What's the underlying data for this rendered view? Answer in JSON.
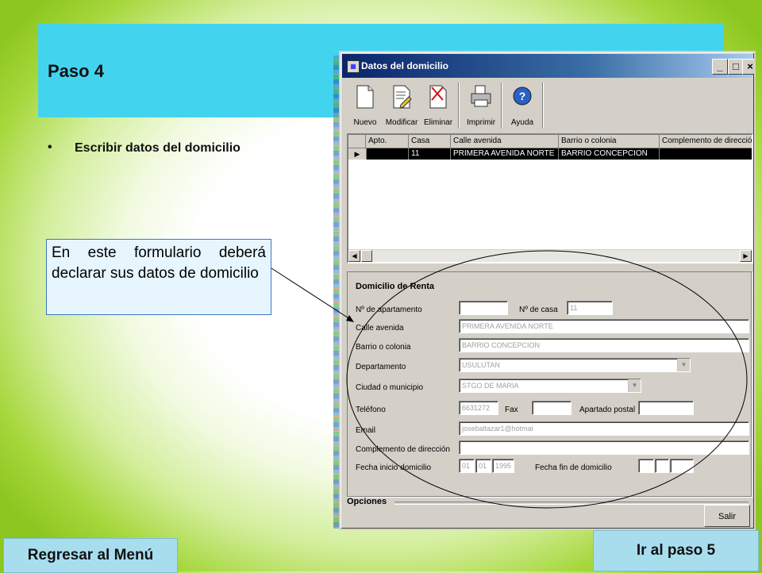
{
  "slide": {
    "title": "Paso 4",
    "bullet": "Escribir datos del domicilio",
    "callout": "En este formulario deberá declarar sus datos de domicilio",
    "nav": {
      "menu": "Regresar al Menú",
      "next": "Ir al paso 5"
    },
    "colors": {
      "header_band": "#42d4ee",
      "nav_button": "#a8ddee",
      "callout_bg": "#e7f5ff",
      "edge_green": "#8cc61f"
    }
  },
  "window": {
    "title": "Datos del domicilio",
    "controls": {
      "minimize": "_",
      "maximize": "□",
      "close": "×"
    },
    "toolbar": [
      {
        "label": "Nuevo",
        "icon": "new-document-icon"
      },
      {
        "label": "Modificar",
        "icon": "edit-document-icon"
      },
      {
        "label": "Eliminar",
        "icon": "delete-document-icon"
      },
      {
        "label": "Imprimir",
        "icon": "printer-icon"
      },
      {
        "label": "Ayuda",
        "icon": "help-icon"
      }
    ],
    "grid": {
      "columns": [
        "Apto.",
        "Casa",
        "Calle avenida",
        "Barrio o colonia",
        "Complemento de dirección"
      ],
      "rows": [
        [
          "",
          "11",
          "PRIMERA AVENIDA NORTE",
          "BARRIO CONCEPCION",
          ""
        ]
      ],
      "row_indicator": "▶"
    },
    "form": {
      "section": "Domicilio de Renta",
      "labels": {
        "apartamento": "Nº de apartamento",
        "casa": "Nº de casa",
        "calle": "Calle avenida",
        "barrio": "Barrio o colonia",
        "departamento": "Departamento",
        "ciudad": "Ciudad o municipio",
        "telefono": "Teléfono",
        "fax": "Fax",
        "apartado": "Apartado postal",
        "email": "Email",
        "complemento": "Complemento de dirección",
        "fecha_inicio": "Fecha inicio domicilio",
        "fecha_fin": "Fecha fin de domicilio"
      },
      "values": {
        "apartamento": "",
        "casa": "11",
        "calle": "PRIMERA AVENIDA NORTE",
        "barrio": "BARRIO CONCEPCION",
        "departamento": "USULUTAN",
        "ciudad": "STGO DE MARIA",
        "telefono": "6631272",
        "fax": "",
        "apartado": "",
        "email": "josebaltazar1@hotmai",
        "complemento": "",
        "fecha_inicio_d": "01",
        "fecha_inicio_m": "01",
        "fecha_inicio_y": "1995",
        "fecha_fin_d": "",
        "fecha_fin_m": "",
        "fecha_fin_y": ""
      }
    },
    "options_label": "Opciones",
    "exit_button": "Salir"
  }
}
